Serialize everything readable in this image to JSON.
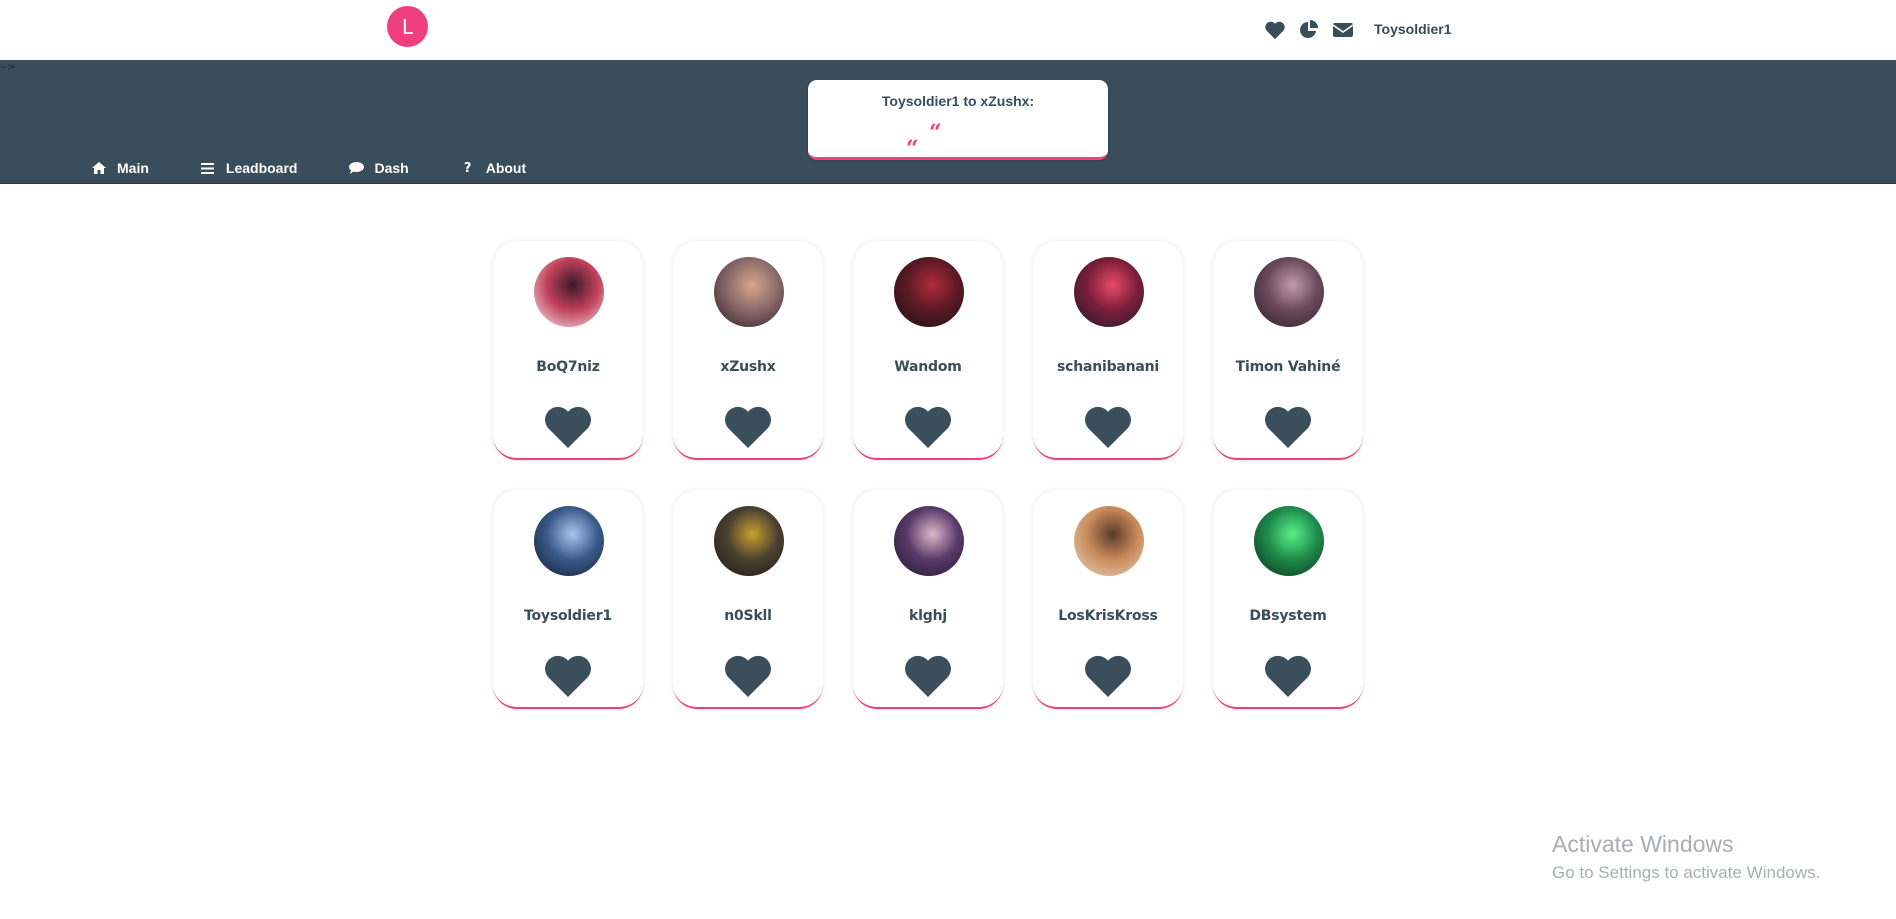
{
  "brand": {
    "logo_letter": "L",
    "color": "#ef3f7f"
  },
  "header": {
    "icons": [
      "heart-icon",
      "pie-chart-icon",
      "envelope-icon"
    ],
    "username": "Toysoldier1"
  },
  "band": {
    "color": "#394d5b",
    "corner_mark": "-->"
  },
  "message": {
    "title": "Toysoldier1 to xZushx:",
    "quote_open": "“",
    "quote_close": "“"
  },
  "nav": {
    "items": [
      {
        "label": "Main",
        "icon": "home-icon",
        "glyph": "⌂"
      },
      {
        "label": "Leadboard",
        "icon": "list-icon",
        "glyph": "☰"
      },
      {
        "label": "Dash",
        "icon": "comment-icon",
        "glyph": "●"
      },
      {
        "label": "About",
        "icon": "question-icon",
        "glyph": "?"
      }
    ]
  },
  "players": [
    {
      "name": "BoQ7niz",
      "avatar_colors": [
        "#f8f0f2",
        "#c0415a",
        "#3a1a28"
      ]
    },
    {
      "name": "xZushx",
      "avatar_colors": [
        "#2a1a22",
        "#8a6a6a",
        "#d8a68c"
      ]
    },
    {
      "name": "Wandom",
      "avatar_colors": [
        "#1a0f14",
        "#5a1a24",
        "#b02a3a"
      ]
    },
    {
      "name": "schanibanani",
      "avatar_colors": [
        "#1e1a2e",
        "#7a1e38",
        "#e84a6a"
      ]
    },
    {
      "name": "Timon Vahiné",
      "avatar_colors": [
        "#2e1a26",
        "#6a4a5a",
        "#c49ab0"
      ]
    },
    {
      "name": "Toysoldier1",
      "avatar_colors": [
        "#0e1a2e",
        "#3a5a8a",
        "#a8c8f0"
      ]
    },
    {
      "name": "n0Skll",
      "avatar_colors": [
        "#1a1810",
        "#4a4030",
        "#c8a030"
      ]
    },
    {
      "name": "klghj",
      "avatar_colors": [
        "#1e1430",
        "#5a3a6a",
        "#e0b8c8"
      ]
    },
    {
      "name": "LosKrisKross",
      "avatar_colors": [
        "#e8d8c0",
        "#c88a5a",
        "#5a3a2a"
      ]
    },
    {
      "name": "DBsystem",
      "avatar_colors": [
        "#0a2a1a",
        "#1e8a4a",
        "#5af08a"
      ]
    }
  ],
  "card_heart_color": "#3b4e5c",
  "watermark": {
    "title": "Activate Windows",
    "subtitle": "Go to Settings to activate Windows."
  }
}
